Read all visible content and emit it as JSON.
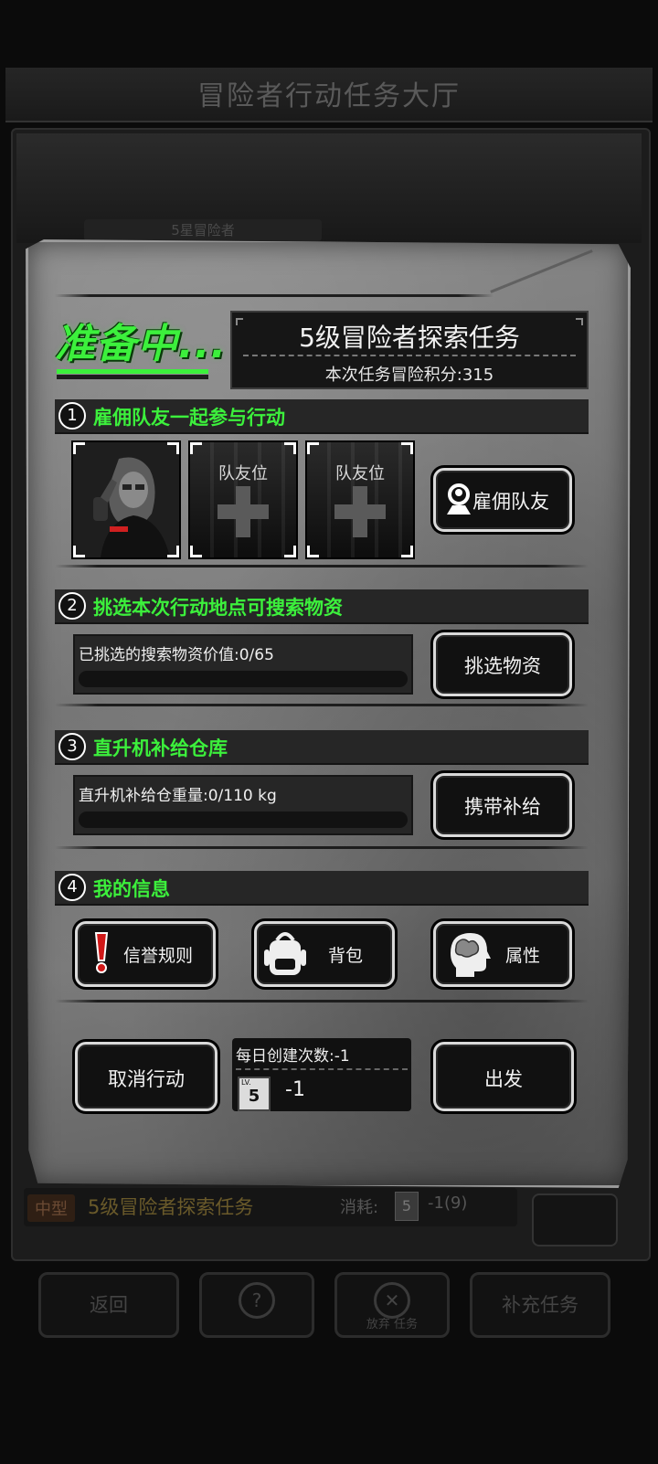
{
  "background": {
    "title": "冒险者行动任务大厅",
    "star_label": "5星冒险者",
    "task_tag": "中型",
    "task_name": "5级冒险者探索任务",
    "consume_label": "消耗:",
    "consume_icon_level": "5",
    "consume_value": "-1(9)",
    "nav": {
      "back": "返回",
      "abandon": "放弃 任务",
      "supplement": "补充任务"
    }
  },
  "dialog": {
    "status": "准备中...",
    "task_title": "5级冒险者探索任务",
    "score_text": "本次任务冒险积分:315",
    "sections": {
      "s1": {
        "num": "1",
        "title": "雇佣队友一起参与行动"
      },
      "s2": {
        "num": "2",
        "title": "挑选本次行动地点可搜索物资"
      },
      "s3": {
        "num": "3",
        "title": "直升机补给仓库"
      },
      "s4": {
        "num": "4",
        "title": "我的信息"
      }
    },
    "slots": [
      {
        "label": ""
      },
      {
        "label": "队友位"
      },
      {
        "label": "队友位"
      }
    ],
    "hire_button": "雇佣队友",
    "supplies": {
      "text": "已挑选的搜索物资价值:0/65",
      "progress": 0,
      "button": "挑选物资"
    },
    "supply_depot": {
      "text": "直升机补给仓重量:0/110 kg",
      "progress": 0,
      "button": "携带补给"
    },
    "info_buttons": {
      "reputation": "信誉规则",
      "backpack": "背包",
      "attributes": "属性"
    },
    "cancel_button": "取消行动",
    "daily": {
      "text": "每日创建次数:-1",
      "ticket_lv": "LV.",
      "ticket_level": "5",
      "value": "-1"
    },
    "depart_button": "出发"
  },
  "colors": {
    "accent_green": "#3cf03c",
    "panel_dark": "#262626",
    "warning_red": "#d01818"
  }
}
